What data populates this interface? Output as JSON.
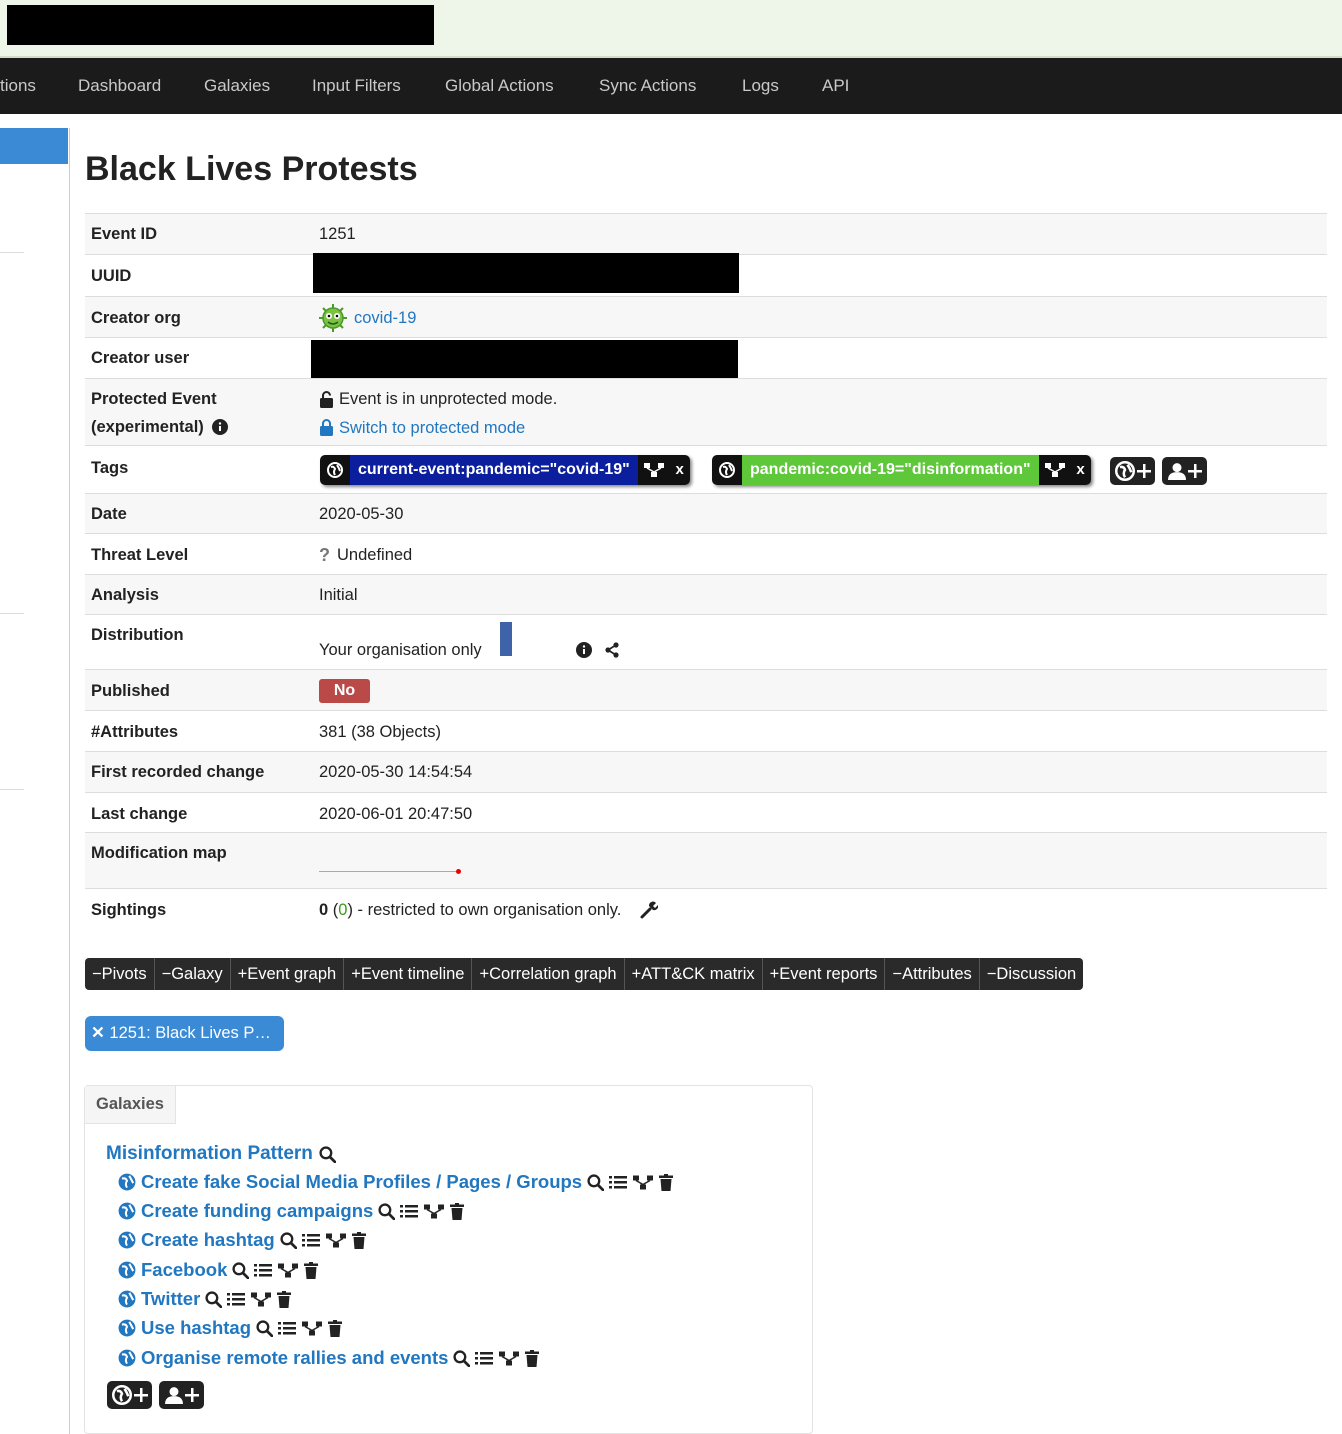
{
  "nav": {
    "items": [
      "tions",
      "Dashboard",
      "Galaxies",
      "Input Filters",
      "Global Actions",
      "Sync Actions",
      "Logs",
      "API"
    ]
  },
  "event": {
    "title": "Black Lives Protests",
    "fields": {
      "event_id_label": "Event ID",
      "event_id": "1251",
      "uuid_label": "UUID",
      "creator_org_label": "Creator org",
      "creator_org": "covid-19",
      "creator_user_label": "Creator user",
      "protected_label_1": "Protected Event",
      "protected_label_2": "(experimental)",
      "protected_status": "Event is in unprotected mode.",
      "protected_switch": "Switch to protected mode",
      "tags_label": "Tags",
      "date_label": "Date",
      "date": "2020-05-30",
      "threat_label": "Threat Level",
      "threat": "Undefined",
      "analysis_label": "Analysis",
      "analysis": "Initial",
      "distribution_label": "Distribution",
      "distribution": "Your organisation only",
      "published_label": "Published",
      "published": "No",
      "attributes_label": "#Attributes",
      "attributes": "381 (38 Objects)",
      "first_change_label": "First recorded change",
      "first_change": "2020-05-30 14:54:54",
      "last_change_label": "Last change",
      "last_change": "2020-06-01 20:47:50",
      "modmap_label": "Modification map",
      "sightings_label": "Sightings",
      "sightings_count": "0",
      "sightings_open": " (",
      "sightings_paren": "0",
      "sightings_text": ") - restricted to own organisation only."
    },
    "tags": [
      {
        "text": "current-event:pandemic=\"covid-19\"",
        "color": "#0b1f9e",
        "remove": "x"
      },
      {
        "text": "pandemic:covid-19=\"disinformation\"",
        "color": "#5ec73a",
        "remove": "x"
      }
    ]
  },
  "tabs": [
    "Pivots",
    "Galaxy",
    "Event graph",
    "Event timeline",
    "Correlation graph",
    "ATT&CK matrix",
    "Event reports",
    "Attributes",
    "Discussion"
  ],
  "tab_signs": [
    "−",
    "−",
    "+",
    "+",
    "+",
    "+",
    "+",
    "−",
    "−"
  ],
  "pivot": {
    "label": "1251: Black Lives P…"
  },
  "galaxies": {
    "header": "Galaxies",
    "cluster_title": "Misinformation Pattern",
    "items": [
      "Create fake Social Media Profiles / Pages / Groups",
      "Create funding campaigns",
      "Create hashtag",
      "Facebook",
      "Twitter",
      "Use hashtag",
      "Organise remote rallies and events"
    ]
  },
  "colors": {
    "accent": "#2177c0",
    "navbar": "#1b1b1b",
    "published_no": "#b94a48"
  }
}
